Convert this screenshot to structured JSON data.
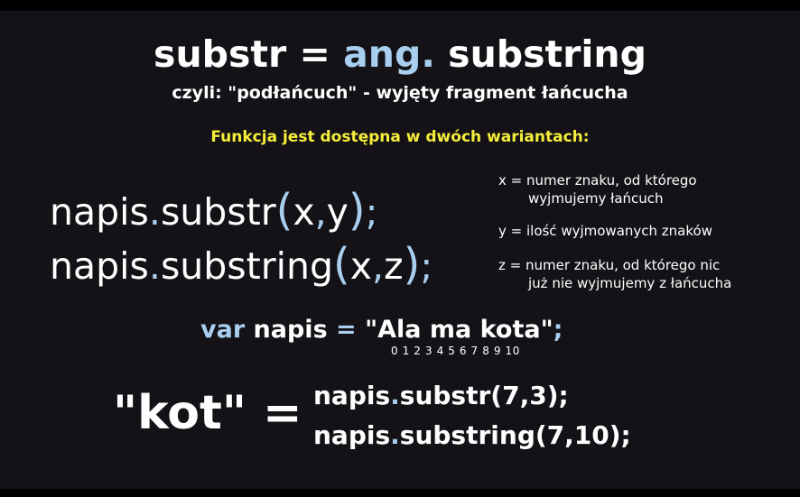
{
  "title": {
    "part1": "substr = ",
    "part2": "ang.",
    "part3": " substring"
  },
  "subtitle": "czyli: \"podłańcuch\" - wyjęty fragment łańcucha",
  "variants_heading": "Funkcja jest dostępna w dwóch wariantach:",
  "code": {
    "line1": {
      "obj": "napis",
      "dot": ".",
      "method": "substr",
      "open": "(",
      "a": "x",
      "comma": ",",
      "b": "y",
      "close": ")",
      "semi": ";"
    },
    "line2": {
      "obj": "napis",
      "dot": ".",
      "method": "substring",
      "open": "(",
      "a": "x",
      "comma": ",",
      "b": "z",
      "close": ")",
      "semi": ";"
    }
  },
  "explanations": {
    "x_line1": "x = numer znaku, od którego",
    "x_line2": "wyjmujemy łańcuch",
    "y_line1": "y = ilość wyjmowanych znaków",
    "z_line1": "z = numer znaku, od którego nic",
    "z_line2": "już nie wyjmujemy z łańcucha"
  },
  "example": {
    "keyword": "var",
    "name": " napis ",
    "equals": "=",
    "value": " \"Ala ma kota\"",
    "semi": ";",
    "indices": "0 1 2 3  4   5 6 7 8 9 10"
  },
  "result": {
    "value": "\"kot\" =",
    "call1": {
      "obj": "napis",
      "dot": ".",
      "method": "substr",
      "args": "(7,3);"
    },
    "call2": {
      "obj": "napis",
      "dot": ".",
      "method": "substring",
      "args": "(7,10);"
    }
  },
  "colors": {
    "highlight": "#a8cff0",
    "heading_yellow": "#f5ee3a",
    "background": "#141216"
  }
}
